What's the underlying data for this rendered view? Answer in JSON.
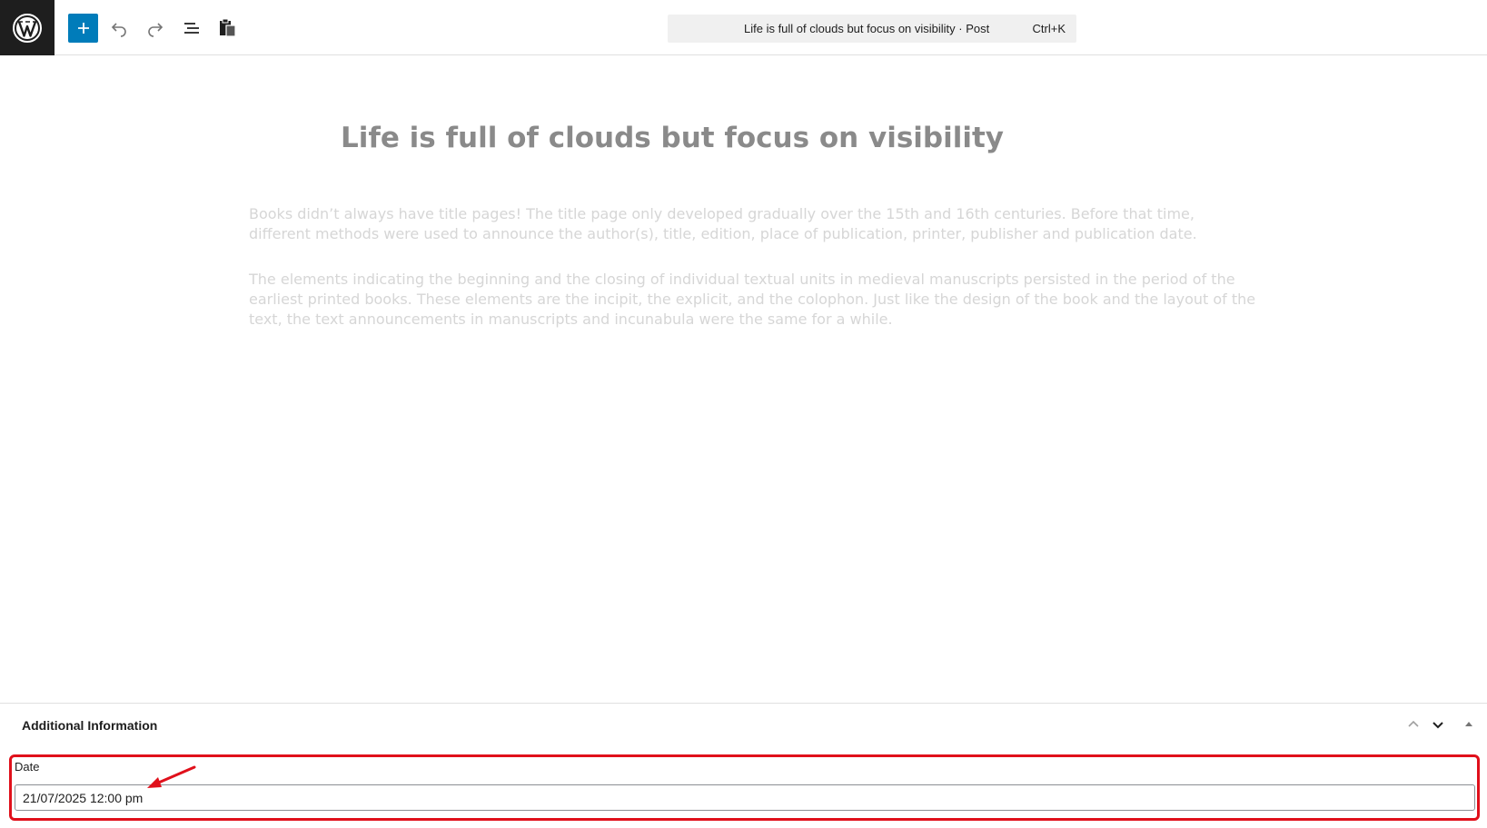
{
  "toolbar": {
    "logo_icon": "wordpress-logo-icon",
    "add_block_icon": "plus-icon",
    "undo_icon": "undo-icon",
    "redo_icon": "redo-icon",
    "outline_icon": "document-outline-icon",
    "clipboard_icon": "clipboard-icon",
    "accent_color": "#007cba"
  },
  "command_bar": {
    "title": "Life is full of clouds but focus on visibility · Post",
    "shortcut": "Ctrl+K"
  },
  "post": {
    "title": "Life is full of clouds but focus on visibility",
    "paragraphs": [
      "Books didn’t always have title pages! The title page only developed gradually over the 15th and 16th centuries. Before that time, different methods were used to announce the author(s), title, edition, place of publication, printer, publisher and publication date.",
      "The elements indicating the beginning and the closing of individual textual units in medieval manuscripts persisted in the period of the earliest printed books. These elements are the incipit, the explicit, and the colophon. Just like the design of the book and the layout of the text, the text announcements in manuscripts and incunabula were the same for a while."
    ]
  },
  "meta_panel": {
    "title": "Additional Information",
    "move_up_icon": "chevron-up-icon",
    "move_down_icon": "chevron-down-icon",
    "toggle_icon": "triangle-up-icon",
    "date_label": "Date",
    "date_value": "21/07/2025 12:00 pm",
    "highlight_color": "#e0101b"
  }
}
